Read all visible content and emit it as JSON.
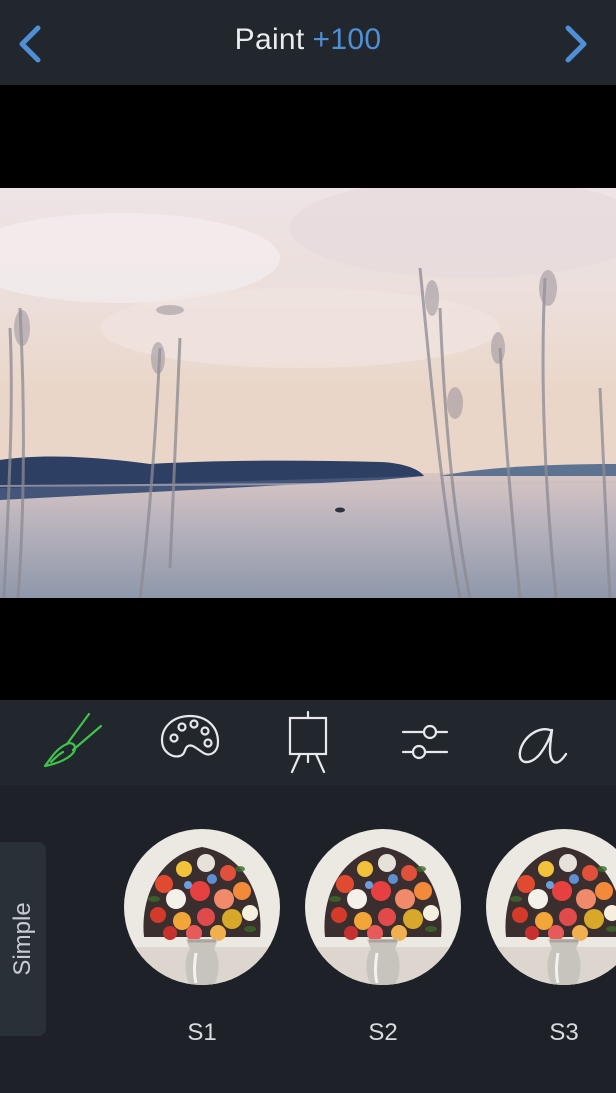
{
  "header": {
    "back_icon": "chevron-left-icon",
    "title": "Paint",
    "value": "+100",
    "forward_icon": "chevron-right-icon",
    "accent_color": "#4f8fd6"
  },
  "toolbar": {
    "tools": [
      {
        "icon": "brush-icon",
        "active": true,
        "color": "#3fc34a"
      },
      {
        "icon": "palette-icon",
        "active": false
      },
      {
        "icon": "easel-icon",
        "active": false
      },
      {
        "icon": "sliders-icon",
        "active": false
      },
      {
        "icon": "font-icon",
        "active": false
      }
    ]
  },
  "panel": {
    "category_tab": "Simple",
    "presets": [
      {
        "label": "S1"
      },
      {
        "label": "S2"
      },
      {
        "label": "S3"
      }
    ]
  }
}
